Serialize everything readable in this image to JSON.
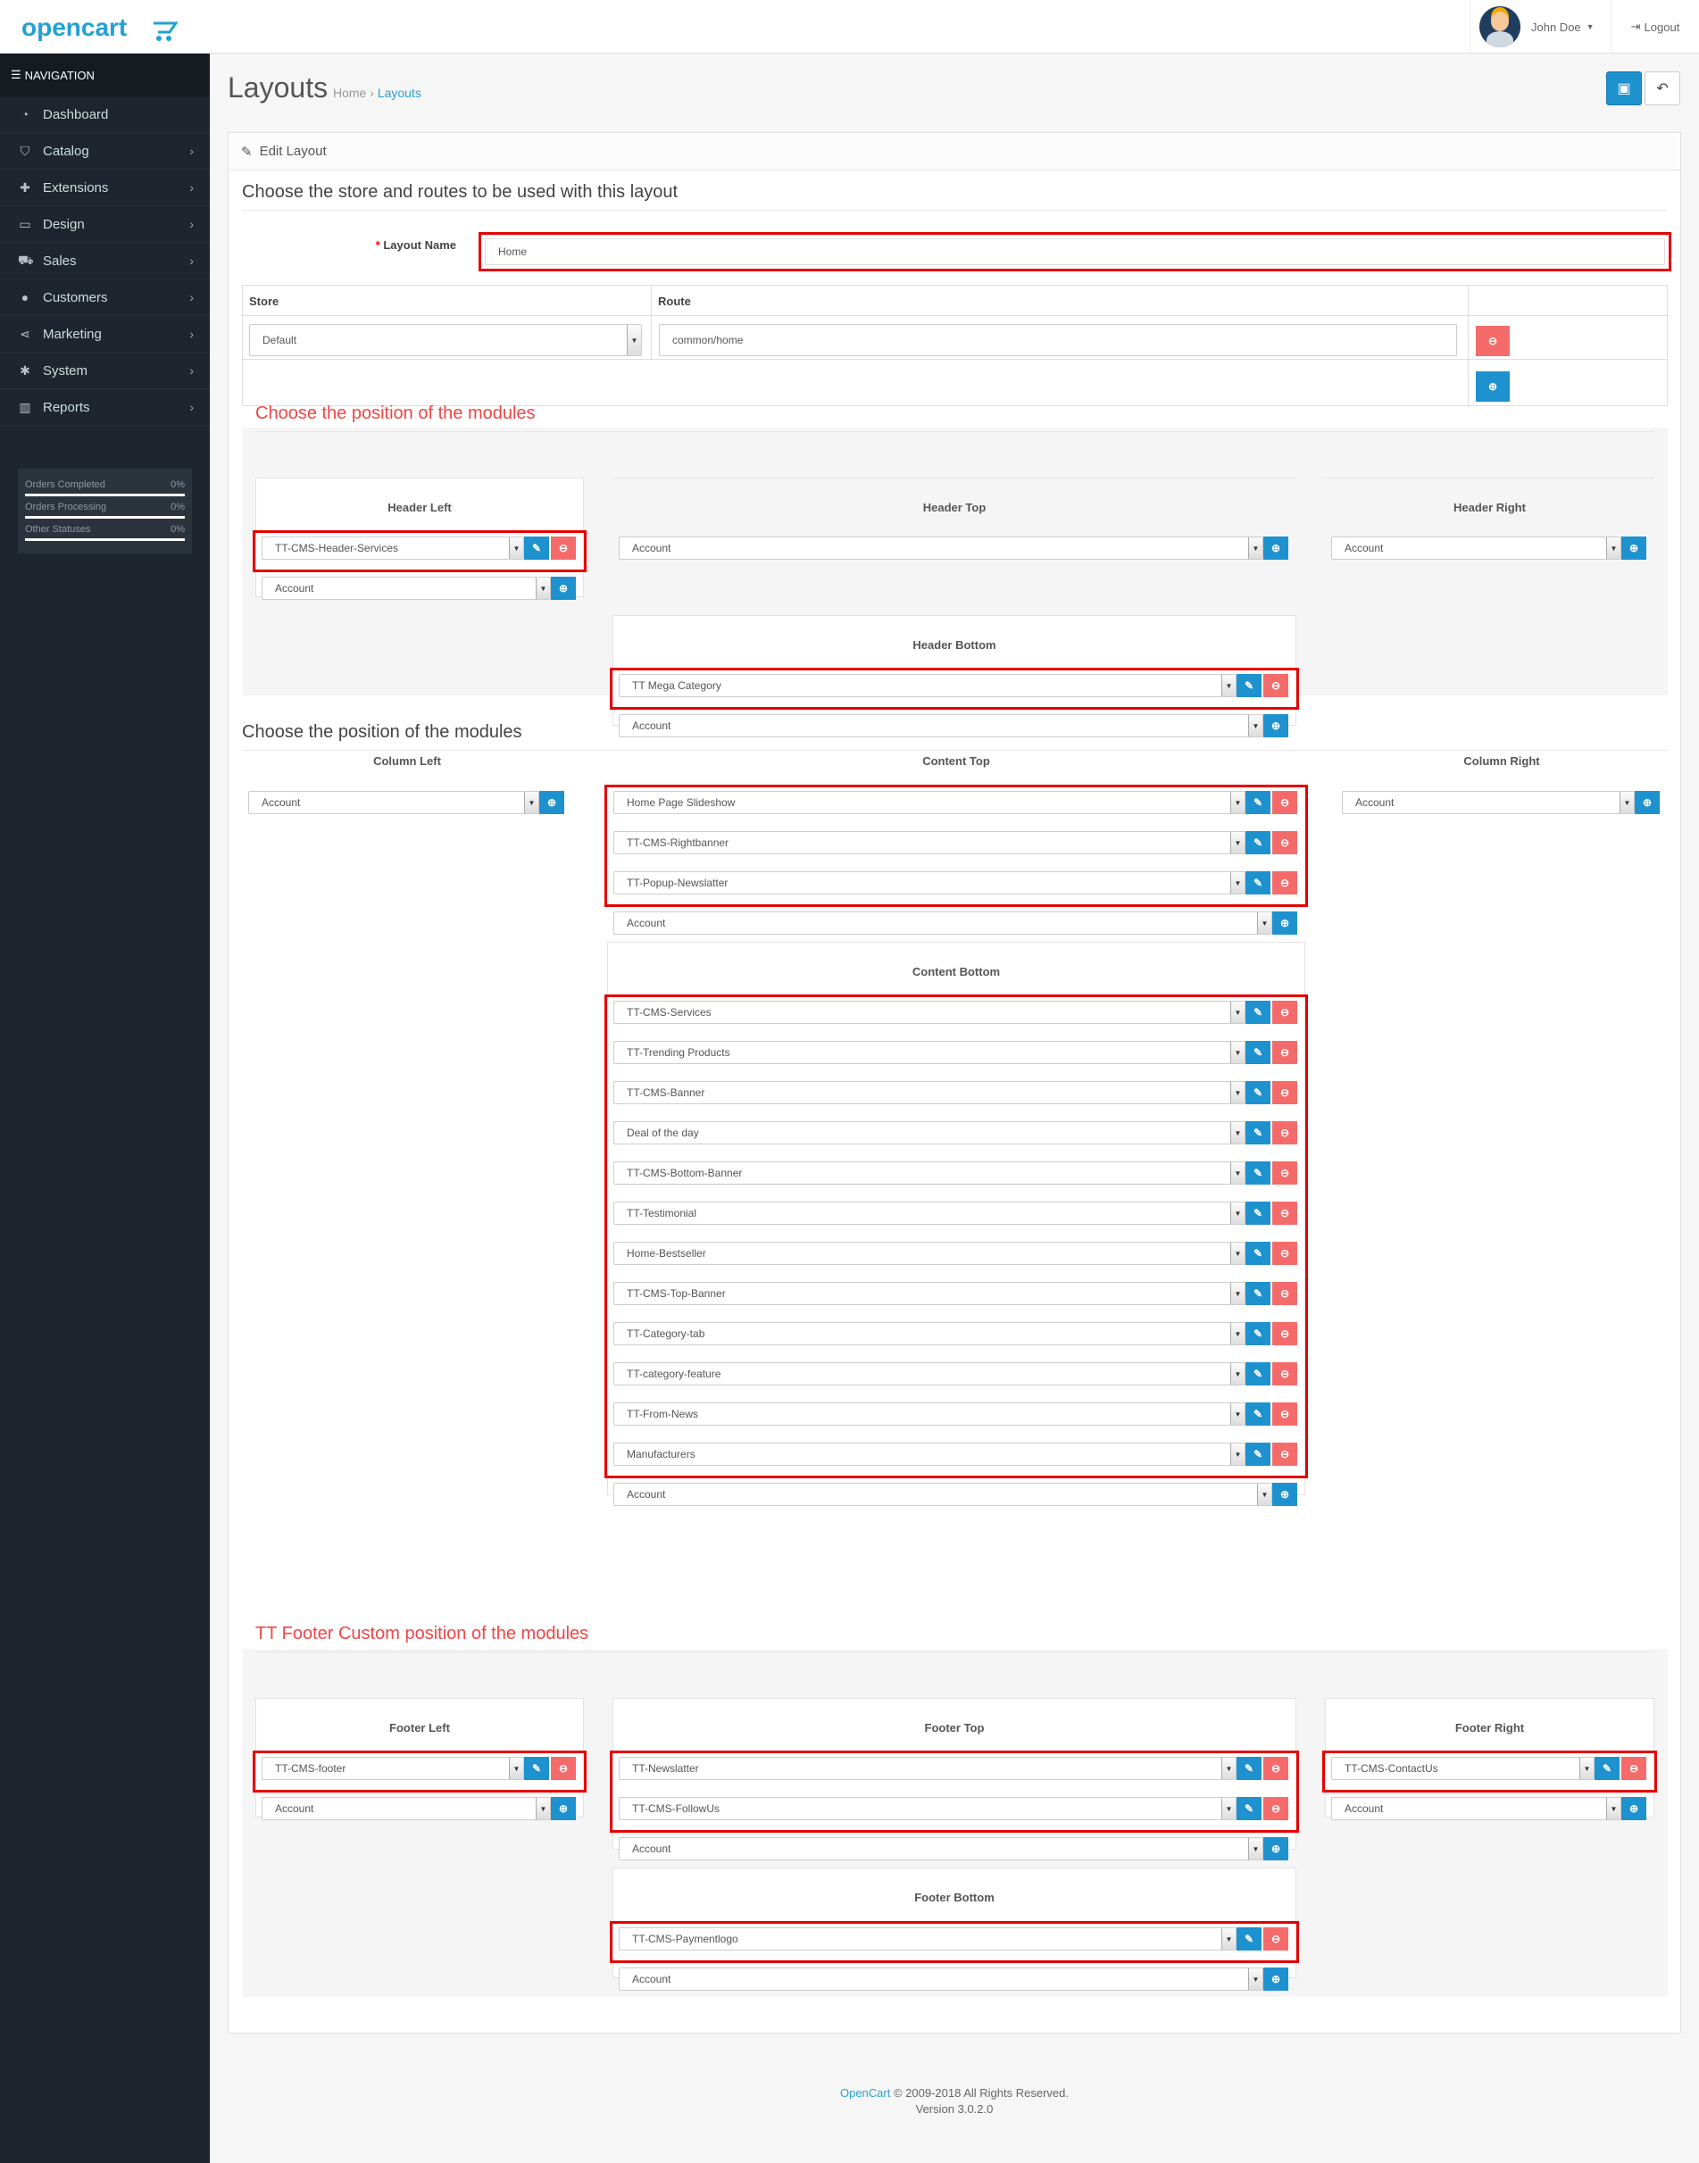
{
  "header": {
    "logo": "opencart",
    "user": "John Doe",
    "logout": "Logout"
  },
  "nav": {
    "heading": "NAVIGATION",
    "items": [
      {
        "label": "Dashboard",
        "icon": "dashboard-icon",
        "glyph": "◔"
      },
      {
        "label": "Catalog",
        "icon": "tag-icon",
        "glyph": "⛉"
      },
      {
        "label": "Extensions",
        "icon": "puzzle-icon",
        "glyph": "✚"
      },
      {
        "label": "Design",
        "icon": "monitor-icon",
        "glyph": "▭"
      },
      {
        "label": "Sales",
        "icon": "cart-icon",
        "glyph": "⛟"
      },
      {
        "label": "Customers",
        "icon": "user-icon",
        "glyph": "●"
      },
      {
        "label": "Marketing",
        "icon": "share-icon",
        "glyph": "⋖"
      },
      {
        "label": "System",
        "icon": "gear-icon",
        "glyph": "✱"
      },
      {
        "label": "Reports",
        "icon": "bar-chart-icon",
        "glyph": "▥"
      }
    ]
  },
  "stats": [
    {
      "label": "Orders Completed",
      "value": "0%"
    },
    {
      "label": "Orders Processing",
      "value": "0%"
    },
    {
      "label": "Other Statuses",
      "value": "0%"
    }
  ],
  "page": {
    "title": "Layouts",
    "breadcrumb": [
      "Home",
      "Layouts"
    ],
    "panel_heading": "Edit Layout"
  },
  "form": {
    "legend": "Choose the store and routes to be used with this layout",
    "layout_name_label": "Layout Name",
    "layout_name_value": "Home",
    "col_store": "Store",
    "col_route": "Route",
    "store_value": "Default",
    "route_value": "common/home"
  },
  "sections": {
    "top": "Choose the position of the modules",
    "middle": "Choose the position of the modules",
    "footer": "TT Footer Custom position of the modules"
  },
  "positions": {
    "header_left": {
      "title": "Header Left",
      "modules": [
        "TT-CMS-Header-Services"
      ],
      "add": "Account"
    },
    "header_top": {
      "title": "Header Top",
      "modules": [],
      "add": "Account"
    },
    "header_right": {
      "title": "Header Right",
      "modules": [],
      "add": "Account"
    },
    "header_bottom": {
      "title": "Header Bottom",
      "modules": [
        "TT Mega Category"
      ],
      "add": "Account"
    },
    "column_left": {
      "title": "Column Left",
      "modules": [],
      "add": "Account"
    },
    "content_top": {
      "title": "Content Top",
      "modules": [
        "Home Page Slideshow",
        "TT-CMS-Rightbanner",
        "TT-Popup-Newslatter"
      ],
      "add": "Account"
    },
    "column_right": {
      "title": "Column Right",
      "modules": [],
      "add": "Account"
    },
    "content_bottom": {
      "title": "Content Bottom",
      "modules": [
        "TT-CMS-Services",
        "TT-Trending Products",
        "TT-CMS-Banner",
        "Deal of the day",
        "TT-CMS-Bottom-Banner",
        "TT-Testimonial",
        "Home-Bestseller",
        "TT-CMS-Top-Banner",
        "TT-Category-tab",
        "TT-category-feature",
        "TT-From-News",
        "Manufacturers"
      ],
      "add": "Account"
    },
    "footer_left": {
      "title": "Footer Left",
      "modules": [
        "TT-CMS-footer"
      ],
      "add": "Account"
    },
    "footer_top": {
      "title": "Footer Top",
      "modules": [
        "TT-Newslatter",
        "TT-CMS-FollowUs"
      ],
      "add": "Account"
    },
    "footer_right": {
      "title": "Footer Right",
      "modules": [
        "TT-CMS-ContactUs"
      ],
      "add": "Account"
    },
    "footer_bottom": {
      "title": "Footer Bottom",
      "modules": [
        "TT-CMS-Paymentlogo"
      ],
      "add": "Account"
    }
  },
  "footer": {
    "link": "OpenCart",
    "copyright": " © 2009-2018 All Rights Reserved.",
    "version": "Version 3.0.2.0"
  }
}
